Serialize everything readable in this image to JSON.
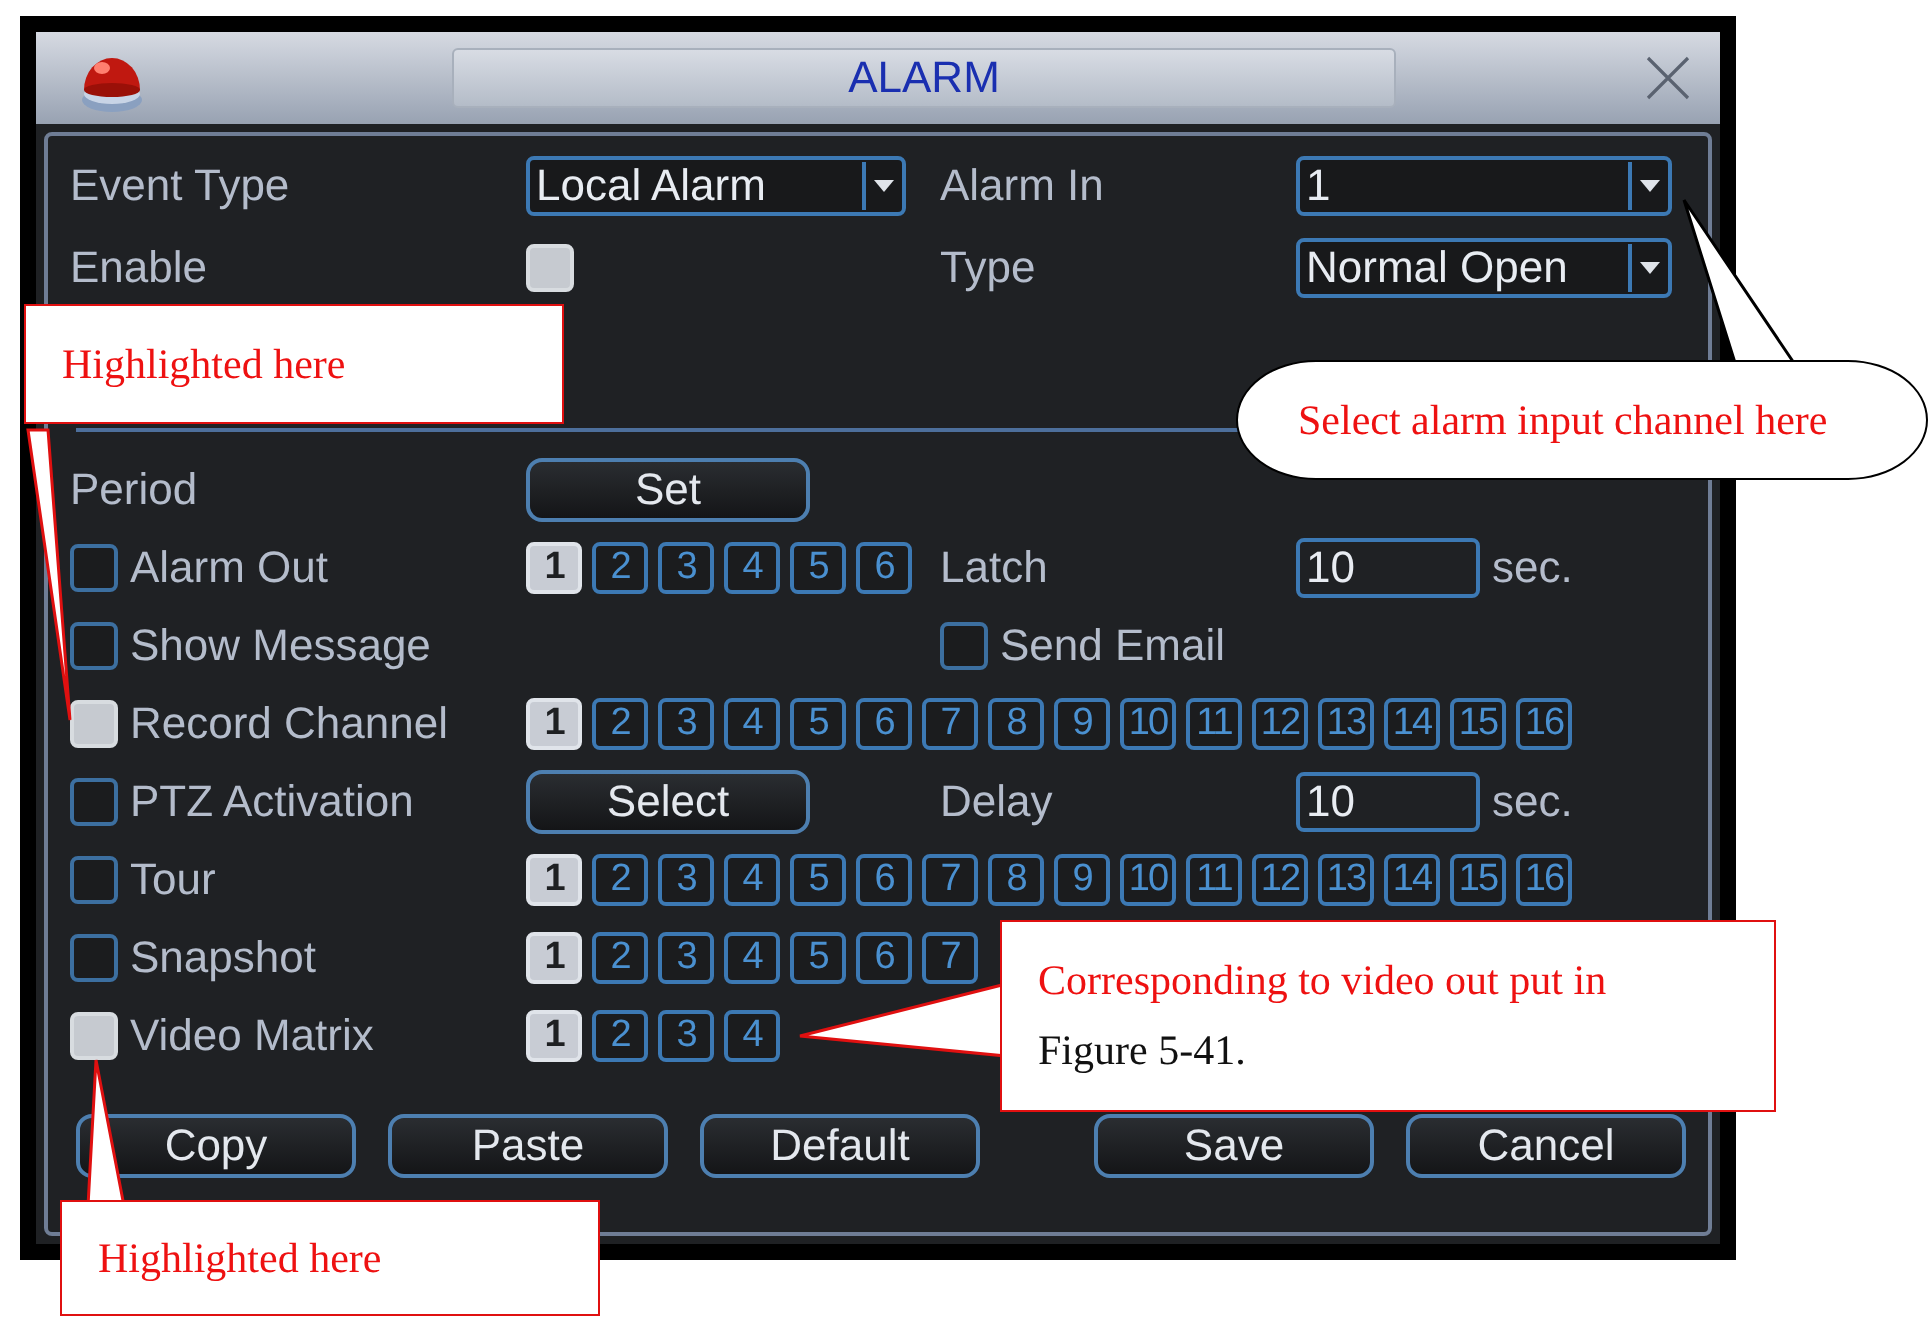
{
  "window": {
    "title": "ALARM"
  },
  "top": [
    {
      "label": "Event Type",
      "kind": "dropdown",
      "value": "Local Alarm"
    },
    {
      "label": "Alarm In",
      "kind": "dropdown",
      "value": "1"
    },
    {
      "label": "Enable",
      "kind": "checkbox",
      "checked": true
    },
    {
      "label": "Type",
      "kind": "dropdown",
      "value": "Normal Open"
    }
  ],
  "rows": [
    {
      "label": "Period",
      "middle": {
        "kind": "button",
        "text": "Set"
      }
    },
    {
      "label": "Alarm Out",
      "checked": false,
      "middle": {
        "kind": "channels",
        "channels": [
          {
            "text": "1",
            "selected": true
          },
          {
            "text": "2",
            "selected": false
          },
          {
            "text": "3",
            "selected": false
          },
          {
            "text": "4",
            "selected": false
          },
          {
            "text": "5",
            "selected": false
          },
          {
            "text": "6",
            "selected": false
          }
        ]
      },
      "right": {
        "kind": "number",
        "label": "Latch",
        "value": "10",
        "unit": "sec."
      }
    },
    {
      "label": "Show Message",
      "checked": false,
      "right": {
        "kind": "check",
        "label": "Send Email",
        "checked": false
      }
    },
    {
      "label": "Record Channel",
      "checked": true,
      "middle": {
        "kind": "channels",
        "channels": [
          {
            "text": "1",
            "selected": true
          },
          {
            "text": "2",
            "selected": false
          },
          {
            "text": "3",
            "selected": false
          },
          {
            "text": "4",
            "selected": false
          },
          {
            "text": "5",
            "selected": false
          },
          {
            "text": "6",
            "selected": false
          },
          {
            "text": "7",
            "selected": false
          },
          {
            "text": "8",
            "selected": false
          },
          {
            "text": "9",
            "selected": false
          },
          {
            "text": "10",
            "selected": false
          },
          {
            "text": "11",
            "selected": false
          },
          {
            "text": "12",
            "selected": false
          },
          {
            "text": "13",
            "selected": false
          },
          {
            "text": "14",
            "selected": false
          },
          {
            "text": "15",
            "selected": false
          },
          {
            "text": "16",
            "selected": false
          }
        ]
      }
    },
    {
      "label": "PTZ Activation",
      "checked": false,
      "middle": {
        "kind": "button",
        "text": "Select"
      },
      "right": {
        "kind": "number",
        "label": "Delay",
        "value": "10",
        "unit": "sec."
      }
    },
    {
      "label": "Tour",
      "checked": false,
      "middle": {
        "kind": "channels",
        "channels": [
          {
            "text": "1",
            "selected": true
          },
          {
            "text": "2",
            "selected": false
          },
          {
            "text": "3",
            "selected": false
          },
          {
            "text": "4",
            "selected": false
          },
          {
            "text": "5",
            "selected": false
          },
          {
            "text": "6",
            "selected": false
          },
          {
            "text": "7",
            "selected": false
          },
          {
            "text": "8",
            "selected": false
          },
          {
            "text": "9",
            "selected": false
          },
          {
            "text": "10",
            "selected": false
          },
          {
            "text": "11",
            "selected": false
          },
          {
            "text": "12",
            "selected": false
          },
          {
            "text": "13",
            "selected": false
          },
          {
            "text": "14",
            "selected": false
          },
          {
            "text": "15",
            "selected": false
          },
          {
            "text": "16",
            "selected": false
          }
        ]
      }
    },
    {
      "label": "Snapshot",
      "checked": false,
      "middle": {
        "kind": "channels",
        "channels": [
          {
            "text": "1",
            "selected": true
          },
          {
            "text": "2",
            "selected": false
          },
          {
            "text": "3",
            "selected": false
          },
          {
            "text": "4",
            "selected": false
          },
          {
            "text": "5",
            "selected": false
          },
          {
            "text": "6",
            "selected": false
          },
          {
            "text": "7",
            "selected": false
          }
        ]
      }
    },
    {
      "label": "Video Matrix",
      "checked": true,
      "middle": {
        "kind": "channels",
        "channels": [
          {
            "text": "1",
            "selected": true
          },
          {
            "text": "2",
            "selected": false
          },
          {
            "text": "3",
            "selected": false
          },
          {
            "text": "4",
            "selected": false
          }
        ]
      }
    }
  ],
  "buttons": [
    "Copy",
    "Paste",
    "Default",
    "Save",
    "Cancel"
  ],
  "callouts": [
    {
      "kind": "box",
      "lines": [
        "Highlighted here"
      ]
    },
    {
      "kind": "cloud",
      "lines": [
        "Select alarm input channel here"
      ]
    },
    {
      "kind": "box",
      "lines": [
        "Corresponding to video out put in",
        "Figure 5-41."
      ]
    },
    {
      "kind": "box",
      "lines": [
        "Highlighted here"
      ]
    }
  ]
}
